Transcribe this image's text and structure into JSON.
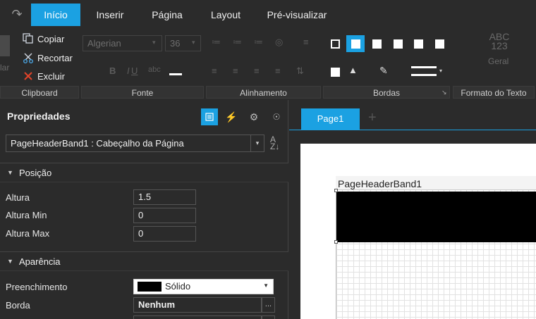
{
  "menu": {
    "tabs": [
      {
        "label": "Início",
        "active": true
      },
      {
        "label": "Inserir",
        "active": false
      },
      {
        "label": "Página",
        "active": false
      },
      {
        "label": "Layout",
        "active": false
      },
      {
        "label": "Pré-visualizar",
        "active": false
      }
    ]
  },
  "ribbon": {
    "clipboard": {
      "paste_label": "lar",
      "copy_label": "Copiar",
      "cut_label": "Recortar",
      "delete_label": "Excluir"
    },
    "font": {
      "family": "Algerian",
      "size": "36"
    },
    "style": {
      "preview_line1": "ABC",
      "preview_line2": "123",
      "label": "Geral"
    },
    "groups": [
      "Clipboard",
      "Fonte",
      "Alinhamento",
      "Bordas",
      "Formato do Texto"
    ]
  },
  "properties": {
    "title": "Propriedades",
    "object": "PageHeaderBand1 : Cabeçalho da Página",
    "sections": {
      "position": "Posição",
      "appearance": "Aparência"
    },
    "fields": {
      "height_label": "Altura",
      "height_value": "1.5",
      "min_height_label": "Altura Min",
      "min_height_value": "0",
      "max_height_label": "Altura Max",
      "max_height_value": "0",
      "fill_label": "Preenchimento",
      "fill_value": "Sólido",
      "border_label": "Borda",
      "border_value": "Nenhum"
    }
  },
  "designer": {
    "page_tab": "Page1",
    "band_name": "PageHeaderBand1"
  },
  "colors": {
    "accent": "#1ba1e2",
    "background": "#2b2b2b",
    "band_fill": "#000000"
  }
}
